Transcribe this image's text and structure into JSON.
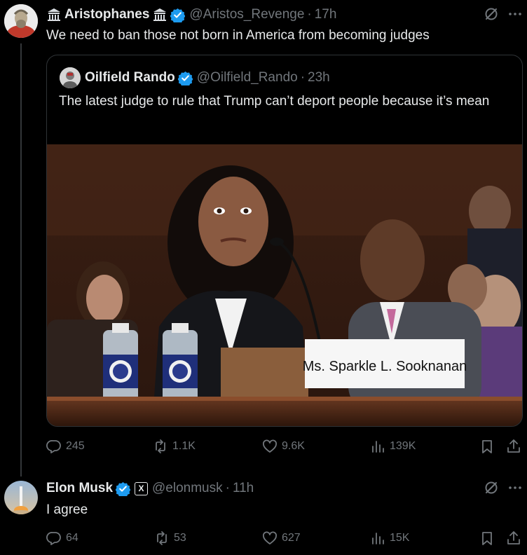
{
  "main_post": {
    "name": "Aristophanes",
    "handle": "@Aristos_Revenge",
    "time": "17h",
    "text": "We need to ban those not born in America from becoming judges",
    "stats": {
      "replies": "245",
      "reposts": "1.1K",
      "likes": "9.6K",
      "views": "139K"
    }
  },
  "quoted_post": {
    "name": "Oilfield Rando",
    "handle": "@Oilfield_Rando",
    "time": "23h",
    "text": "The latest judge to rule that Trump can’t deport people because it’s mean",
    "image": {
      "nameplate": "Ms. Sparkle L. Sooknanan"
    }
  },
  "reply_post": {
    "name": "Elon Musk",
    "handle": "@elonmusk",
    "time": "11h",
    "badge": "X",
    "text": "I agree",
    "stats": {
      "replies": "64",
      "reposts": "53",
      "likes": "627",
      "views": "15K"
    }
  },
  "colors": {
    "background": "#000000",
    "text": "#e7e9ea",
    "muted": "#71767b",
    "verified": "#1d9bf0"
  }
}
